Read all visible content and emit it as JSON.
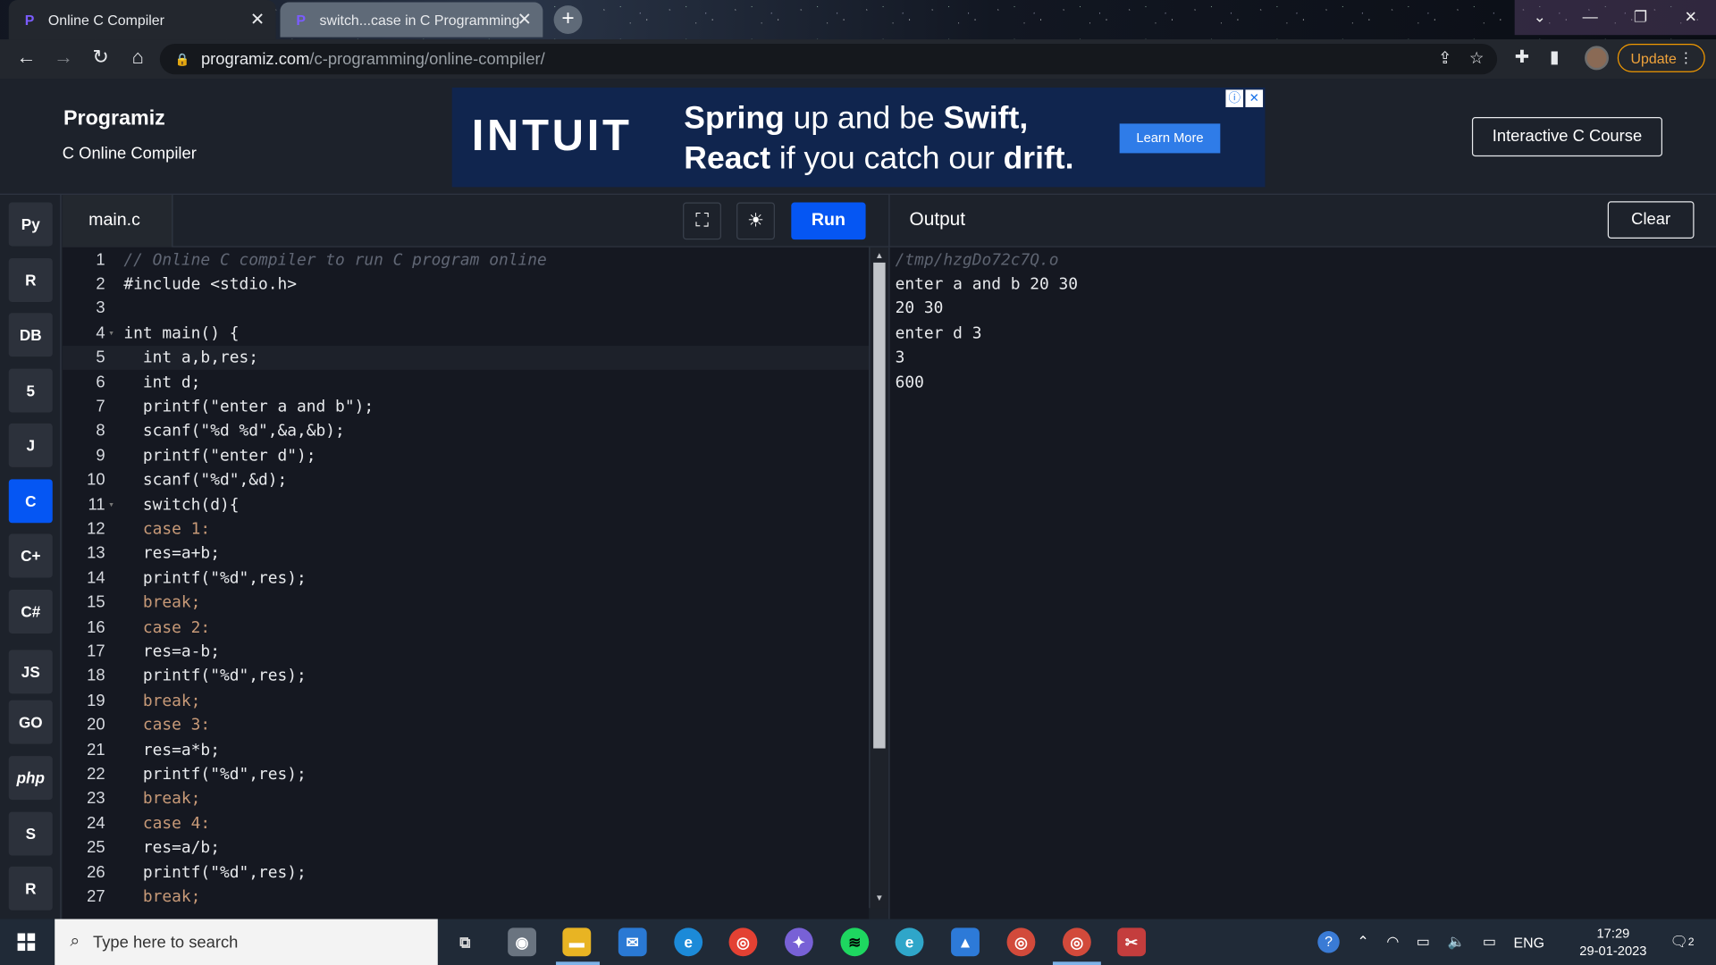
{
  "browser": {
    "tabs": [
      {
        "title": "Online C Compiler",
        "active": true
      },
      {
        "title": "switch...case in C Programming",
        "active": false
      }
    ],
    "url_host": "programiz.com",
    "url_path": "/c-programming/online-compiler/",
    "update_label": "Update"
  },
  "header": {
    "logo_text": "Programiz",
    "subtitle": "C Online Compiler",
    "course_button": "Interactive C Course"
  },
  "ad": {
    "brand": "INTUIT",
    "line1_a": "Spring",
    "line1_b": " up and be ",
    "line1_c": "Swift,",
    "line2_a": "React",
    "line2_b": " if you catch our ",
    "line2_c": "drift.",
    "cta": "Learn More"
  },
  "languages": [
    {
      "name": "python",
      "glyph": "Py"
    },
    {
      "name": "r",
      "glyph": "R"
    },
    {
      "name": "sql",
      "glyph": "DB"
    },
    {
      "name": "html",
      "glyph": "5"
    },
    {
      "name": "java",
      "glyph": "J"
    },
    {
      "name": "c",
      "glyph": "C",
      "active": true
    },
    {
      "name": "cpp",
      "glyph": "C+"
    },
    {
      "name": "csharp",
      "glyph": "C#"
    },
    {
      "name": "javascript",
      "glyph": "JS"
    },
    {
      "name": "go",
      "glyph": "GO"
    },
    {
      "name": "php",
      "glyph": "php"
    },
    {
      "name": "swift",
      "glyph": "S"
    },
    {
      "name": "rust",
      "glyph": "R"
    }
  ],
  "editor": {
    "filename": "main.c",
    "run_label": "Run",
    "lines": [
      "// Online C compiler to run C program online",
      "#include <stdio.h>",
      "",
      "int main() {",
      "  int a,b,res;",
      "  int d;",
      "  printf(\"enter a and b\");",
      "  scanf(\"%d %d\",&a,&b);",
      "  printf(\"enter d\");",
      "  scanf(\"%d\",&d);",
      "  switch(d){",
      "  case 1:",
      "  res=a+b;",
      "  printf(\"%d\",res);",
      "  break;",
      "  case 2:",
      "  res=a-b;",
      "  printf(\"%d\",res);",
      "  break;",
      "  case 3:",
      "  res=a*b;",
      "  printf(\"%d\",res);",
      "  break;",
      "  case 4:",
      "  res=a/b;",
      "  printf(\"%d\",res);",
      "  break;"
    ]
  },
  "output": {
    "title": "Output",
    "clear_label": "Clear",
    "lines": [
      "/tmp/hzgDo72c7Q.o",
      "enter a and b 20 30",
      "20 30",
      "enter d 3",
      "3",
      "600"
    ]
  },
  "taskbar": {
    "search_placeholder": "Type here to search",
    "language": "ENG",
    "time": "17:29",
    "date": "29-01-2023",
    "notifications": "2"
  }
}
